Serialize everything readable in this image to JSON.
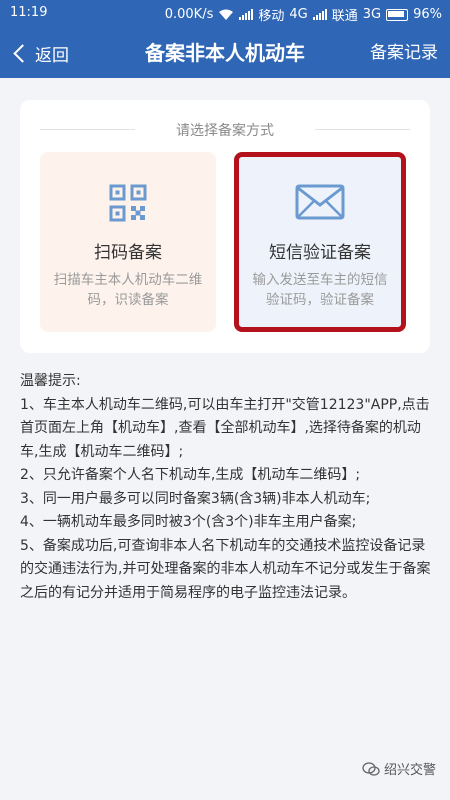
{
  "status_bar": {
    "time": "11:19",
    "speed": "0.00K/s",
    "carrier1": "移动",
    "net1": "4G",
    "carrier2": "联通",
    "net2": "3G",
    "battery": "96%"
  },
  "nav": {
    "back_label": "返回",
    "title": "备案非本人机动车",
    "right_action": "备案记录"
  },
  "card": {
    "prompt": "请选择备案方式",
    "options": [
      {
        "title": "扫码备案",
        "desc": "扫描车主本人机动车二维码，识读备案",
        "icon": "qr-code-icon"
      },
      {
        "title": "短信验证备案",
        "desc": "输入发送至车主的短信验证码，验证备案",
        "icon": "envelope-icon"
      }
    ]
  },
  "tips": {
    "heading": "温馨提示:",
    "items": [
      "1、车主本人机动车二维码,可以由车主打开\"交管12123\"APP,点击首页面左上角【机动车】,查看【全部机动车】,选择待备案的机动车,生成【机动车二维码】;",
      "2、只允许备案个人名下机动车,生成【机动车二维码】;",
      "3、同一用户最多可以同时备案3辆(含3辆)非本人机动车;",
      "4、一辆机动车最多同时被3个(含3个)非车主用户备案;",
      "5、备案成功后,可查询非本人名下机动车的交通技术监控设备记录的交通违法行为,并可处理备案的非本人机动车不记分或发生于备案之后的有记分并适用于简易程序的电子监控违法记录。"
    ]
  },
  "watermark": "绍兴交警",
  "colors": {
    "nav_bg": "#2f66b5",
    "page_bg": "#f2f4f8",
    "qr_card_bg": "#fdf3ec",
    "sms_card_bg": "#eef3fb",
    "highlight_border": "#b3121c",
    "icon_blue": "#6a9ad0"
  }
}
